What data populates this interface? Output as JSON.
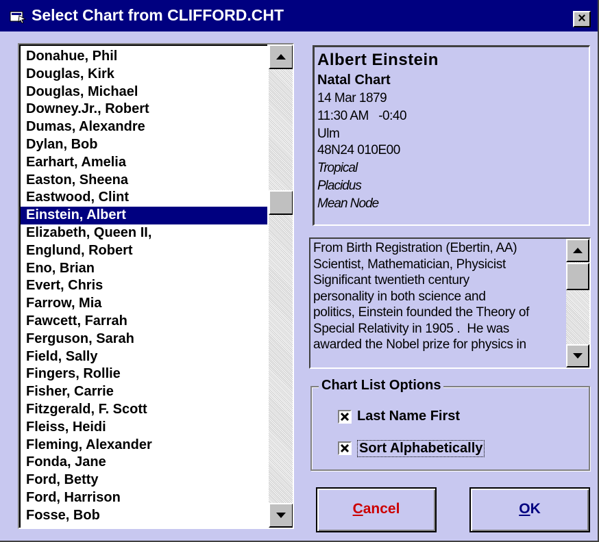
{
  "window": {
    "title": "Select Chart from CLIFFORD.CHT",
    "close_label": "×"
  },
  "chart_list": {
    "items": [
      "Donahue, Phil",
      "Douglas, Kirk",
      "Douglas, Michael",
      "Downey.Jr., Robert",
      "Dumas, Alexandre",
      "Dylan, Bob",
      "Earhart, Amelia",
      "Easton, Sheena",
      "Eastwood, Clint",
      "Einstein, Albert",
      "Elizabeth, Queen II,",
      "Englund, Robert",
      "Eno, Brian",
      "Evert, Chris",
      "Farrow, Mia",
      "Fawcett, Farrah",
      "Ferguson, Sarah",
      "Field, Sally",
      "Fingers, Rollie",
      "Fisher, Carrie",
      "Fitzgerald, F. Scott",
      "Fleiss, Heidi",
      "Fleming, Alexander",
      "Fonda, Jane",
      "Ford, Betty",
      "Ford, Harrison",
      "Fosse, Bob"
    ],
    "selected_index": 9
  },
  "chart_info": {
    "name": "Albert Einstein",
    "chart_type": "Natal Chart",
    "date": "14 Mar 1879",
    "time_zone": "11:30 AM   -0:40",
    "place": "Ulm",
    "coordinates": "48N24 010E00",
    "zodiac": "Tropical",
    "house_system": "Placidus",
    "node": "Mean Node"
  },
  "notes": {
    "lines": [
      "From Birth Registration (Ebertin, AA)",
      "Scientist, Mathematician, Physicist",
      "Significant twentieth century",
      "personality in both science and",
      "politics, Einstein founded the Theory of",
      "Special Relativity in 1905 .  He was",
      "awarded the Nobel prize for physics in"
    ]
  },
  "options": {
    "legend": "Chart List Options",
    "last_name_first": {
      "label": "Last Name First",
      "checked": true
    },
    "sort_alphabetically": {
      "label": "Sort Alphabetically",
      "checked": true
    }
  },
  "buttons": {
    "cancel_first": "C",
    "cancel_rest": "ancel",
    "ok_first": "O",
    "ok_rest": "K"
  },
  "colors": {
    "title_bar": "#000080",
    "dialog_background": "#c8c8f0",
    "selection": "#000080",
    "cancel_text": "#cc0000",
    "ok_text": "#000080"
  }
}
